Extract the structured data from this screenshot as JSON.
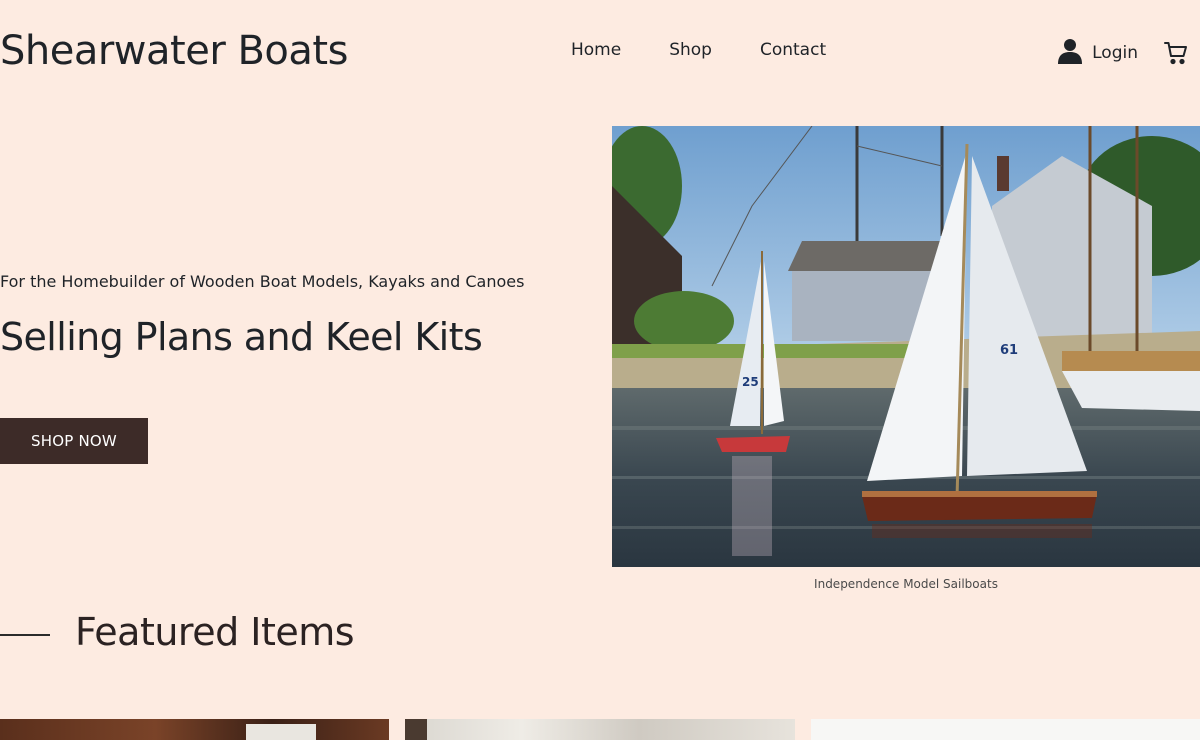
{
  "header": {
    "site_title": "Shearwater Boats",
    "nav": [
      {
        "label": "Home"
      },
      {
        "label": "Shop"
      },
      {
        "label": "Contact"
      }
    ],
    "login_label": "Login",
    "icons": {
      "account": "user-icon",
      "cart": "cart-icon"
    }
  },
  "hero": {
    "eyebrow": "For the Homebuilder of Wooden Boat Models, Kayaks and Canoes",
    "headline": "Selling Plans and Keel Kits",
    "cta_label": "SHOP NOW",
    "image_caption": "Independence Model Sailboats",
    "sail_numbers": [
      "25",
      "61"
    ]
  },
  "featured": {
    "title": "Featured Items"
  },
  "colors": {
    "background": "#fdebe1",
    "cta_background": "#3d2b28",
    "text": "#1f2328"
  }
}
